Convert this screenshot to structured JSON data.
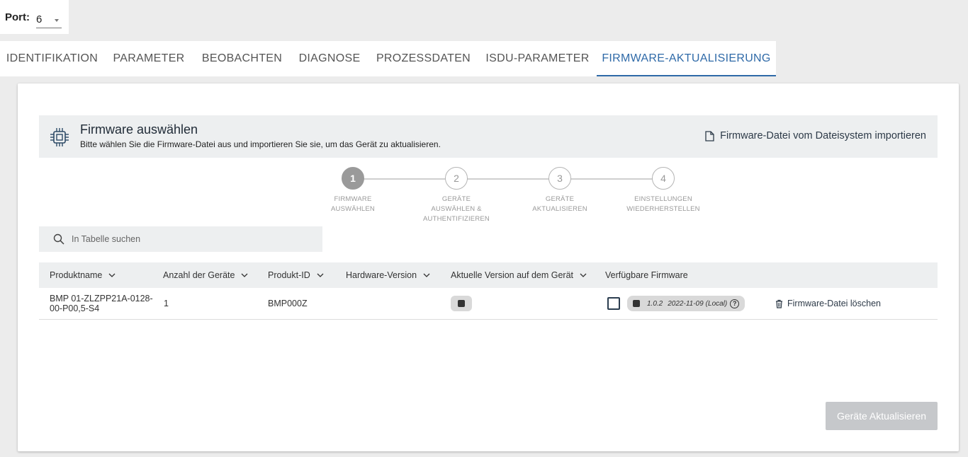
{
  "port": {
    "label": "Port:",
    "value": "6"
  },
  "tabs": [
    {
      "label": "IDENTIFIKATION"
    },
    {
      "label": "PARAMETER"
    },
    {
      "label": "BEOBACHTEN"
    },
    {
      "label": "DIAGNOSE"
    },
    {
      "label": "PROZESSDATEN"
    },
    {
      "label": "ISDU-PARAMETER"
    },
    {
      "label": "FIRMWARE-AKTUALISIERUNG",
      "active": true
    }
  ],
  "header": {
    "title": "Firmware auswählen",
    "subtitle": "Bitte wählen Sie die Firmware-Datei aus und importieren Sie sie, um das Gerät zu aktualisieren.",
    "import_label": "Firmware-Datei vom Dateisystem importieren"
  },
  "stepper": [
    {
      "number": "1",
      "line1": "FIRMWARE",
      "line2": "AUSWÄHLEN",
      "line3": "",
      "active": true
    },
    {
      "number": "2",
      "line1": "GERÄTE",
      "line2": "AUSWÄHLEN &",
      "line3": "AUTHENTIFIZIEREN"
    },
    {
      "number": "3",
      "line1": "GERÄTE",
      "line2": "AKTUALISIEREN",
      "line3": ""
    },
    {
      "number": "4",
      "line1": "EINSTELLUNGEN",
      "line2": "WIEDERHERSTELLEN",
      "line3": ""
    }
  ],
  "search": {
    "placeholder": "In Tabelle suchen"
  },
  "table": {
    "columns": [
      "Produktname",
      "Anzahl der Geräte",
      "Produkt-ID",
      "Hardware-Version",
      "Aktuelle Version auf dem Gerät",
      "Verfügbare Firmware"
    ],
    "rows": [
      {
        "product_name": "BMP 01-ZLZPP21A-0128-00-P00,5-S4",
        "device_count": "1",
        "product_id": "BMP000Z",
        "hardware_version": "",
        "firmware_version": "1.0.2",
        "firmware_date": "2022-11-09",
        "firmware_source": "(Local)",
        "help": "?",
        "delete_label": "Firmware-Datei löschen"
      }
    ]
  },
  "update_button": "Geräte Aktualisieren",
  "colors": {
    "accent": "#2f6aa8",
    "panel": "#edeff0",
    "disabled": "#c6c8cb"
  }
}
